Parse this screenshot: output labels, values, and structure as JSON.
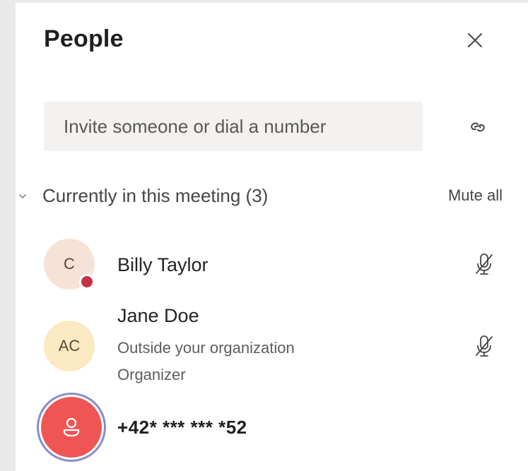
{
  "panel": {
    "title": "People"
  },
  "invite": {
    "placeholder": "Invite someone or dial a number"
  },
  "section": {
    "label": "Currently in this meeting (3)",
    "mute_all_label": "Mute all"
  },
  "participants": [
    {
      "initials": "C",
      "name": "Billy Taylor",
      "avatar_color": "#f6e2d6",
      "presence_color": "#c4314b",
      "mic": "mic-off-icon"
    },
    {
      "initials": "AC",
      "name": "Jane Doe",
      "subtitle1": "Outside your organization",
      "subtitle2": "Organizer",
      "avatar_color": "#fbe9c1",
      "mic": "mic-off-icon"
    },
    {
      "name": "+42* *** *** *52",
      "avatar_color": "#ef5552",
      "icon": "phone-user-icon"
    }
  ],
  "colors": {
    "panel_bg": "#ffffff",
    "input_bg": "#f3f2f1",
    "outer_bg": "#e9e9e9",
    "ring": "#8b8cc7"
  }
}
